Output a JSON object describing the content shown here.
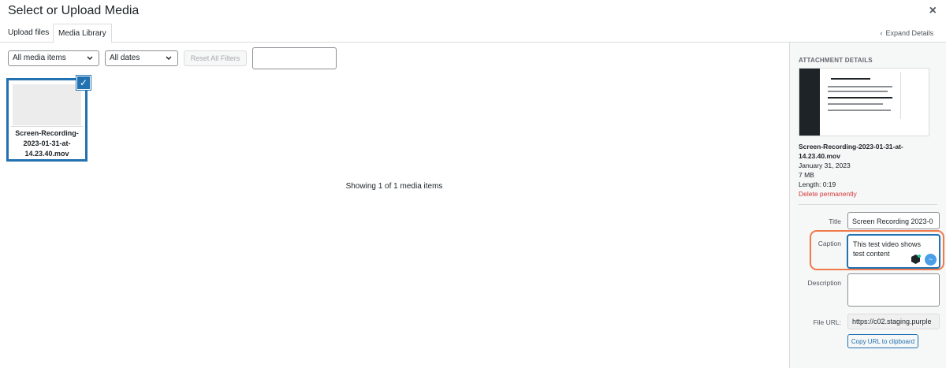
{
  "header": {
    "title": "Select or Upload Media",
    "close_glyph": "×"
  },
  "tabs": [
    {
      "label": "Upload files",
      "active": false
    },
    {
      "label": "Media Library",
      "active": true
    }
  ],
  "expand": {
    "chevron": "‹",
    "label": "Expand Details"
  },
  "toolbar": {
    "type_filter": "All media items",
    "date_filter": "All dates",
    "reset_label": "Reset All Filters",
    "search_value": ""
  },
  "media_items": [
    {
      "caption": "Screen-Recording-2023-01-31-at-14.23.40.mov",
      "selected": true,
      "check_glyph": "✓"
    }
  ],
  "status": {
    "showing": "Showing 1 of 1 media items"
  },
  "details": {
    "heading": "ATTACHMENT DETAILS",
    "file_name": "Screen-Recording-2023-01-31-at-14.23.40.mov",
    "date": "January 31, 2023",
    "size": "7 MB",
    "length": "Length: 0:19",
    "delete_label": "Delete permanently",
    "fields": {
      "title_label": "Title",
      "title_value": "Screen Recording 2023-0",
      "caption_label": "Caption",
      "caption_value": "This test video shows test content",
      "description_label": "Description",
      "description_value": "",
      "file_url_label": "File URL:",
      "file_url_value": "https://c02.staging.purple"
    },
    "copy_label": "Copy URL to clipboard",
    "bubble_glyph": "~"
  },
  "colors": {
    "accent": "#2271b1",
    "danger": "#d63638",
    "highlight": "#f07a4a"
  },
  "icons": [
    "close-icon",
    "chevron-left-icon",
    "chevron-down-icon",
    "checkmark-icon",
    "grammarly-icon",
    "assistant-bubble-icon"
  ]
}
